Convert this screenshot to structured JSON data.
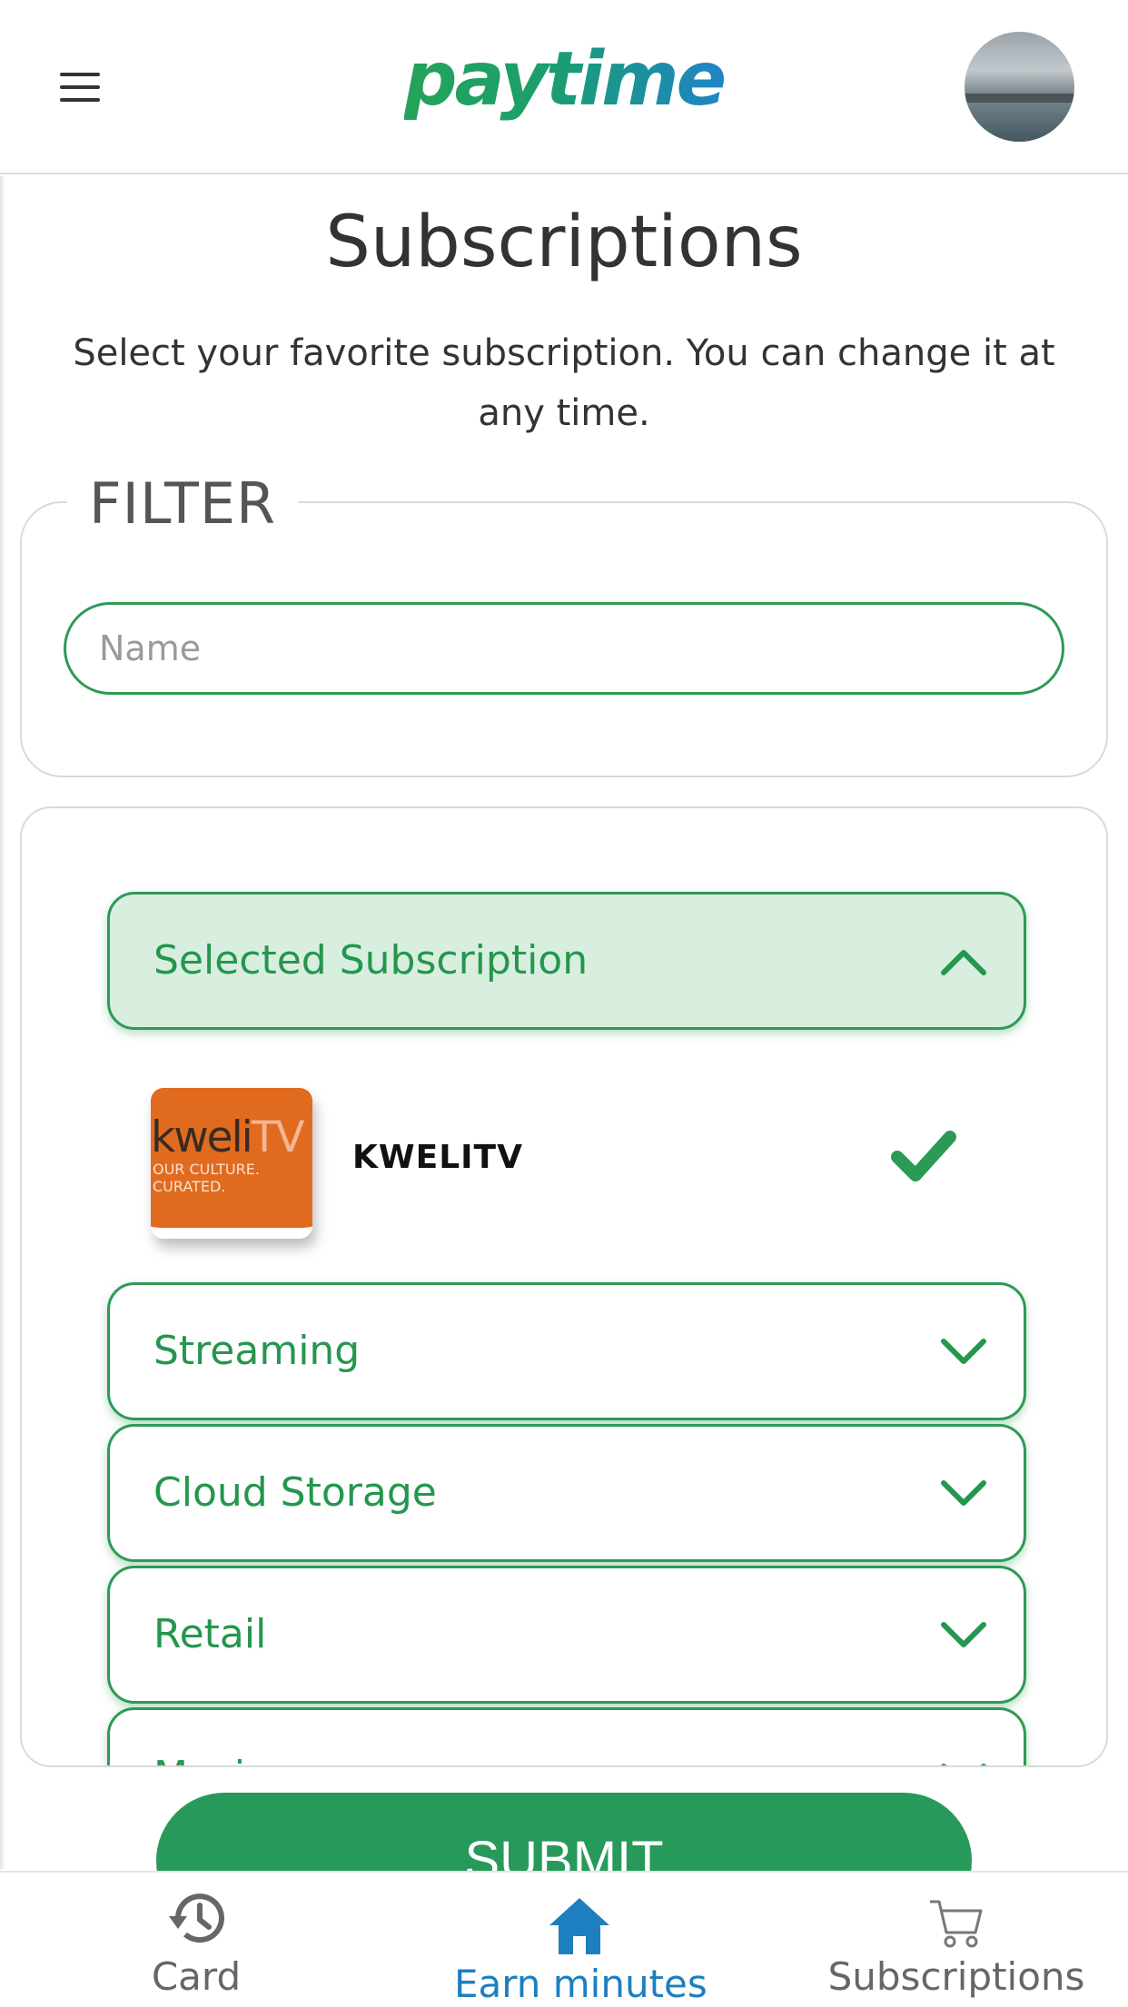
{
  "header": {
    "brand": "paytime",
    "menu_icon": "hamburger-icon",
    "avatar_icon": "profile-photo"
  },
  "page": {
    "title": "Subscriptions",
    "subtitle": "Select your favorite subscription. You can change it at any time."
  },
  "filter": {
    "legend": "FILTER",
    "name_placeholder": "Name",
    "name_value": ""
  },
  "selected_section": {
    "label": "Selected Subscription",
    "icon": "chevron-up-icon",
    "item": {
      "logo_text_dark": "kweli",
      "logo_text_light": "TV",
      "logo_tagline": "OUR CULTURE.\nCURATED.",
      "name": "KWELITV",
      "status_icon": "checkmark-icon"
    }
  },
  "categories": [
    {
      "label": "Streaming",
      "icon": "chevron-down-icon"
    },
    {
      "label": "Cloud Storage",
      "icon": "chevron-down-icon"
    },
    {
      "label": "Retail",
      "icon": "chevron-down-icon"
    },
    {
      "label": "Music",
      "icon": "chevron-down-icon"
    }
  ],
  "submit": {
    "label": "SUBMIT"
  },
  "bottom_nav": {
    "items": [
      {
        "label": "Card",
        "icon": "history-icon",
        "active": false
      },
      {
        "label": "Earn minutes",
        "icon": "home-icon",
        "active": true
      },
      {
        "label": "Subscriptions",
        "icon": "cart-icon",
        "active": false
      }
    ]
  },
  "colors": {
    "primary_green": "#27995a",
    "accordion_green": "#2e9a55",
    "selected_bg": "#d8efe0",
    "active_nav_blue": "#1d7fc0",
    "kwelitv_orange": "#e06b1f"
  }
}
